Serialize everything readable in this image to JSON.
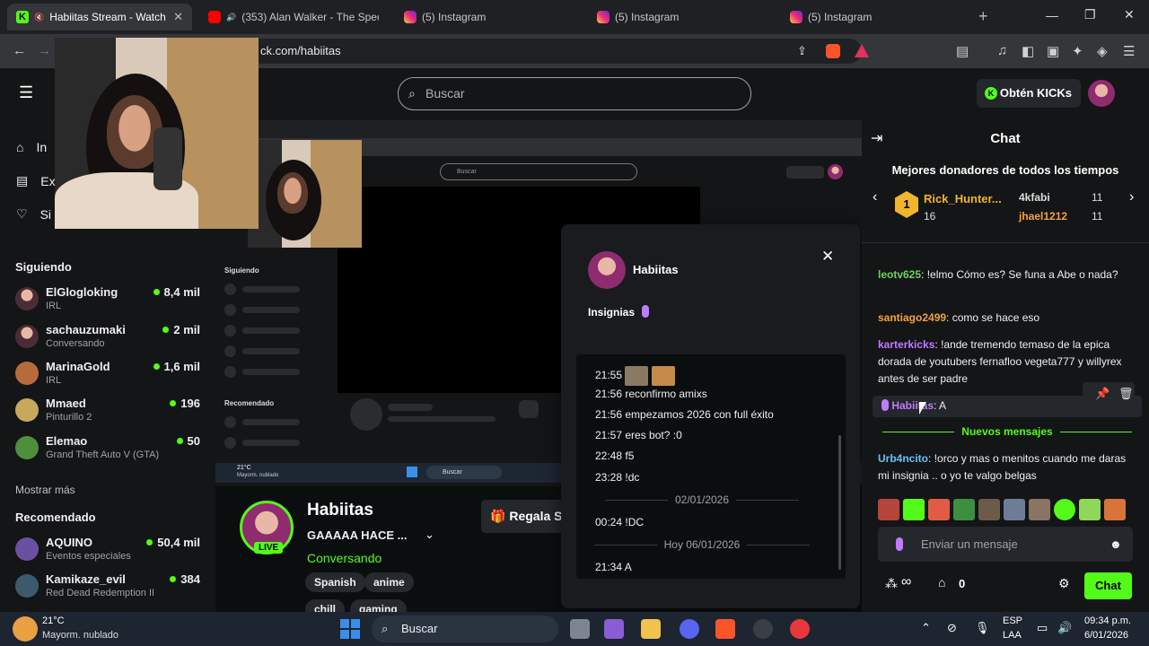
{
  "browser": {
    "tabs": [
      {
        "label": "Habiitas Stream - Watch Li",
        "icon": "kick"
      },
      {
        "label": "(353) Alan Walker - The Spect",
        "icon": "youtube"
      },
      {
        "label": "(5) Instagram",
        "icon": "instagram"
      },
      {
        "label": "(5) Instagram",
        "icon": "instagram"
      },
      {
        "label": "(5) Instagram",
        "icon": "instagram"
      }
    ],
    "url": "ck.com/habiitas",
    "new_tab": "+"
  },
  "header": {
    "search_placeholder": "Buscar",
    "kicks_button": "Obtén KICKs"
  },
  "sidebar": {
    "nav": [
      "In",
      "Ex",
      "Si"
    ],
    "following_title": "Siguiendo",
    "following": [
      {
        "name": "ElGlogloking",
        "category": "IRL",
        "viewers": "8,4 mil"
      },
      {
        "name": "sachauzumaki",
        "category": "Conversando",
        "viewers": "2 mil"
      },
      {
        "name": "MarinaGold",
        "category": "IRL",
        "viewers": "1,6 mil"
      },
      {
        "name": "Mmaed",
        "category": "Pinturillo 2",
        "viewers": "196"
      },
      {
        "name": "Elemao",
        "category": "Grand Theft Auto V (GTA)",
        "viewers": "50"
      }
    ],
    "show_more": "Mostrar más",
    "recommended_title": "Recomendado",
    "recommended": [
      {
        "name": "AQUINO",
        "category": "Eventos especiales",
        "viewers": "50,4 mil"
      },
      {
        "name": "Kamikaze_evil",
        "category": "Red Dead Redemption II",
        "viewers": "384"
      }
    ]
  },
  "inner_screen": {
    "search": "Buscar",
    "side_following": "Siguiendo",
    "side_recommended": "Recomendado",
    "weather": "21°C",
    "weather_sub": "Mayorm. nublado",
    "taskbar_search": "Buscar"
  },
  "stream": {
    "name": "Habiitas",
    "title": "GAAAAA HACE ...",
    "category": "Conversando",
    "live_badge": "LIVE",
    "gift_button": "Regala S",
    "tags": [
      "Spanish",
      "anime",
      "chill",
      "gaming"
    ]
  },
  "popup": {
    "username": "Habiitas",
    "badges_label": "Insignias",
    "history": [
      {
        "type": "msg",
        "text": "21:55"
      },
      {
        "type": "msg",
        "text": "21:56 reconfirmo amixs"
      },
      {
        "type": "msg",
        "text": "21:56 empezamos 2026 con full éxito"
      },
      {
        "type": "msg",
        "text": "21:57 eres bot? :0"
      },
      {
        "type": "msg",
        "text": "22:48 f5"
      },
      {
        "type": "msg",
        "text": "23:28 !dc"
      },
      {
        "type": "date",
        "text": "02/01/2026"
      },
      {
        "type": "msg",
        "text": "00:24 !DC"
      },
      {
        "type": "date",
        "text": "Hoy 06/01/2026"
      },
      {
        "type": "msg",
        "text": "21:34 A"
      }
    ]
  },
  "chat": {
    "title": "Chat",
    "donors_title": "Mejores donadores de todos los tiempos",
    "top_donor": {
      "rank": "1",
      "name": "Rick_Hunter...",
      "amount": "16"
    },
    "donor2": {
      "name": "4kfabi",
      "amount": "11"
    },
    "donor3": {
      "name": "jhael1212",
      "amount": "11"
    },
    "messages": [
      {
        "user": "leotv625",
        "text": "!elmo Cómo es? Se funa a Abe o nada?",
        "color": "#6bd55c"
      },
      {
        "user": "santiago2499",
        "text": "como se hace eso",
        "color": "#f5a13c"
      },
      {
        "user": "karterkicks",
        "text": "!ande tremendo temaso de la epica dorada de youtubers fernafloo vegeta777 y willyrex antes de ser padre",
        "color": "#c17bff"
      },
      {
        "user": "Habiitas",
        "text": "A",
        "color": "#c17bff"
      },
      {
        "user": "Urb4ncito",
        "text": "!orco y mas o menitos cuando me daras mi insignia .. o yo te valgo belgas",
        "color": "#67c1f5"
      }
    ],
    "new_messages": "Nuevos mensajes",
    "input_placeholder": "Enviar un mensaje",
    "infinity": "∞",
    "points": "0",
    "send_button": "Chat"
  },
  "taskbar": {
    "weather_temp": "21°C",
    "weather_desc": "Mayorm. nublado",
    "search": "Buscar",
    "lang": "ESP",
    "lang2": "LAA",
    "time": "09:34 p.m.",
    "date": "6/01/2026"
  }
}
